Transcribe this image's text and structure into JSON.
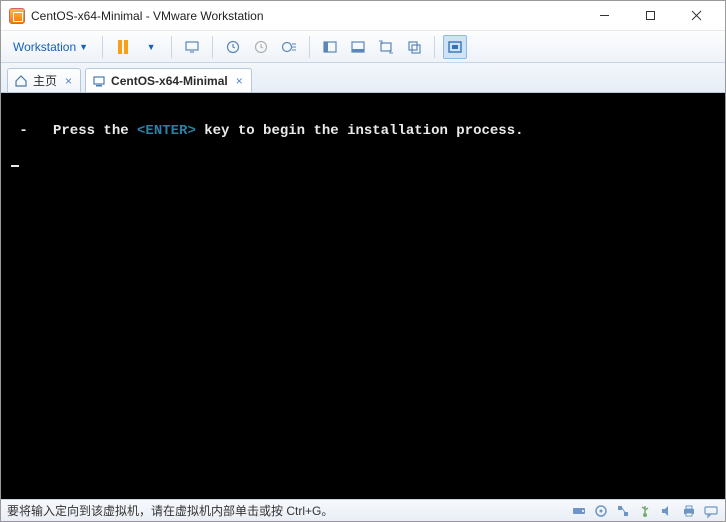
{
  "titlebar": {
    "title": "CentOS-x64-Minimal - VMware Workstation"
  },
  "menubar": {
    "workstation_label": "Workstation"
  },
  "tabs": {
    "home_label": "主页",
    "vm_label": "CentOS-x64-Minimal"
  },
  "terminal": {
    "prefix": " -   Press the ",
    "enter_key": "<ENTER>",
    "suffix": " key to begin the installation process."
  },
  "statusbar": {
    "message": "要将输入定向到该虚拟机，请在虚拟机内部单击或按 Ctrl+G。"
  }
}
